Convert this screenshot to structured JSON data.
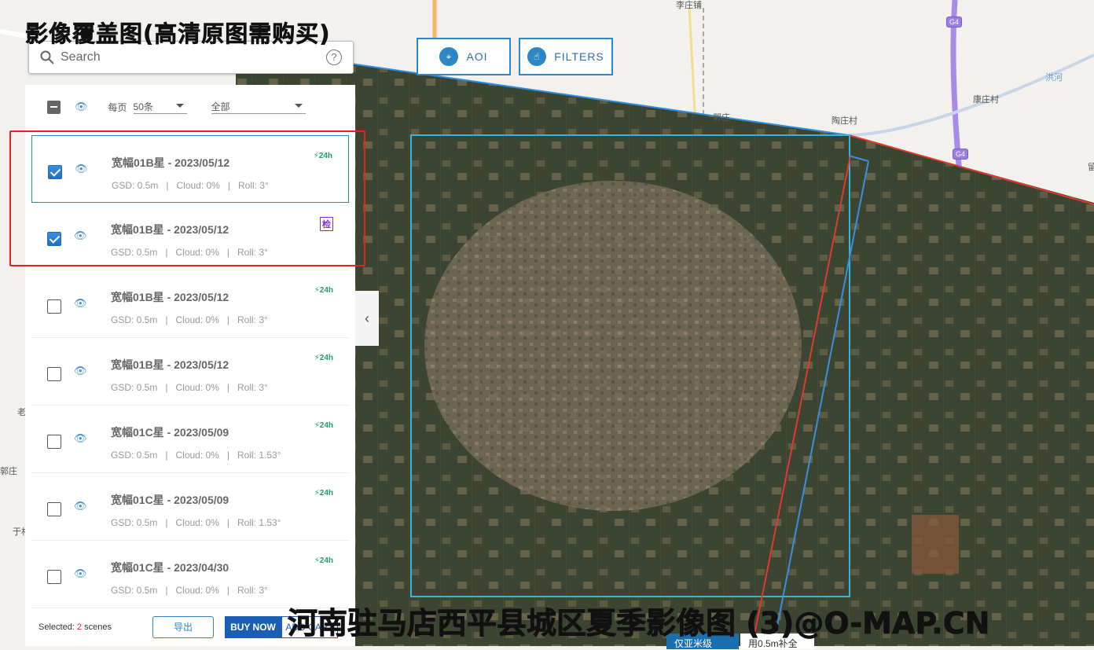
{
  "overlay_title": "影像覆盖图(高清原图需购买)",
  "watermark": "河南驻马店西平县城区夏季影像图 (3)@O-MAP.CN",
  "search": {
    "placeholder": "Search",
    "help": "?"
  },
  "toolbar": {
    "aoi": "AOI",
    "filters": "FILTERS"
  },
  "list_header": {
    "per_page_label": "每页",
    "per_page_value": "50条",
    "filter_value": "全部"
  },
  "items": [
    {
      "title": "宽幅01B星 - 2023/05/12",
      "gsd": "GSD: 0.5m",
      "cloud": "Cloud: 0%",
      "roll": "Roll: 3°",
      "badge": "24h",
      "checked": true
    },
    {
      "title": "宽幅01B星 - 2023/05/12",
      "gsd": "GSD: 0.5m",
      "cloud": "Cloud: 0%",
      "roll": "Roll: 3°",
      "badge": "检",
      "checked": true
    },
    {
      "title": "宽幅01B星 - 2023/05/12",
      "gsd": "GSD: 0.5m",
      "cloud": "Cloud: 0%",
      "roll": "Roll: 3°",
      "badge": "24h",
      "checked": false
    },
    {
      "title": "宽幅01B星 - 2023/05/12",
      "gsd": "GSD: 0.5m",
      "cloud": "Cloud: 0%",
      "roll": "Roll: 3°",
      "badge": "24h",
      "checked": false
    },
    {
      "title": "宽幅01C星 - 2023/05/09",
      "gsd": "GSD: 0.5m",
      "cloud": "Cloud: 0%",
      "roll": "Roll: 1.53°",
      "badge": "24h",
      "checked": false
    },
    {
      "title": "宽幅01C星 - 2023/05/09",
      "gsd": "GSD: 0.5m",
      "cloud": "Cloud: 0%",
      "roll": "Roll: 1.53°",
      "badge": "24h",
      "checked": false
    },
    {
      "title": "宽幅01C星 - 2023/04/30",
      "gsd": "GSD: 0.5m",
      "cloud": "Cloud: 0%",
      "roll": "Roll: 3°",
      "badge": "24h",
      "checked": false
    }
  ],
  "footer": {
    "selected_prefix": "Selected: ",
    "selected_count": "2",
    "selected_suffix": " scenes",
    "export": "导出",
    "buy_now": "BUY NOW",
    "add_cart": "ADD CART"
  },
  "map": {
    "labels": [
      "李庄铺",
      "郭庄",
      "陶庄村",
      "康庄村",
      "洪河",
      "郭庄",
      "老",
      "于村",
      "留"
    ],
    "highway": "G4",
    "btn_submeter": "仅亚米级",
    "btn_fill": "用0.5m补全"
  },
  "colors": {
    "accent": "#2f86c6",
    "highlight_box": "#e0261e",
    "footprint_red": "#e03a2e",
    "footprint_blue": "#3a8fe0"
  }
}
